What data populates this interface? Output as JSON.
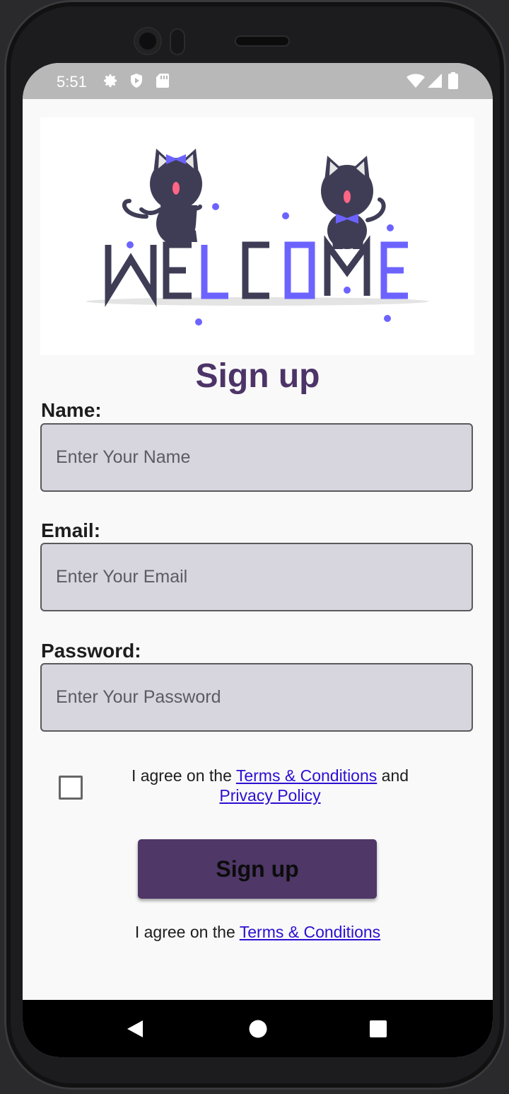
{
  "status_bar": {
    "time": "5:51",
    "left_icons": [
      "gear-icon",
      "shield-play-icon",
      "sd-card-icon"
    ],
    "right_icons": [
      "wifi-icon",
      "signal-icon",
      "battery-icon"
    ]
  },
  "hero": {
    "image": "welcome-cats-illustration",
    "letters": [
      "W",
      "E",
      "L",
      "C",
      "O",
      "M",
      "E"
    ]
  },
  "form": {
    "title": "Sign up",
    "name_label": "Name:",
    "name_placeholder": "Enter Your Name",
    "email_label": "Email:",
    "email_placeholder": "Enter Your Email",
    "password_label": "Password:",
    "password_placeholder": "Enter Your Password",
    "agree_prefix": "I agree on the ",
    "terms_link": "Terms & Conditions",
    "agree_and": " and",
    "privacy_link": "Privacy Policy",
    "submit_label": "Sign up",
    "footer_prefix": "I agree on the ",
    "footer_terms_link": "Terms & Conditions"
  },
  "colors": {
    "title": "#4c3468",
    "button": "#4f3768",
    "field_bg": "#d7d5de",
    "link": "#2c0fd2",
    "accent": "#6c63ff"
  },
  "nav_bar": {
    "buttons": [
      "back-icon",
      "home-icon",
      "recents-icon"
    ]
  }
}
